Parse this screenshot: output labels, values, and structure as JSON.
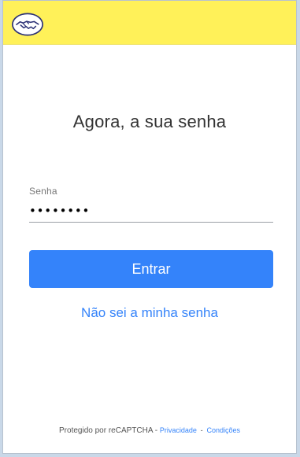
{
  "brand": {
    "logo_icon": "handshake-icon",
    "header_color": "#fff159"
  },
  "page": {
    "title": "Agora, a sua senha"
  },
  "form": {
    "password_label": "Senha",
    "password_value": "••••••••",
    "submit_label": "Entrar",
    "forgot_label": "Não sei a minha senha"
  },
  "footer": {
    "protected_by": "Protegido por reCAPTCHA -",
    "privacy_label": "Privacidade",
    "separator": "-",
    "terms_label": "Condições"
  },
  "colors": {
    "accent": "#3483fa",
    "header": "#fff159"
  }
}
